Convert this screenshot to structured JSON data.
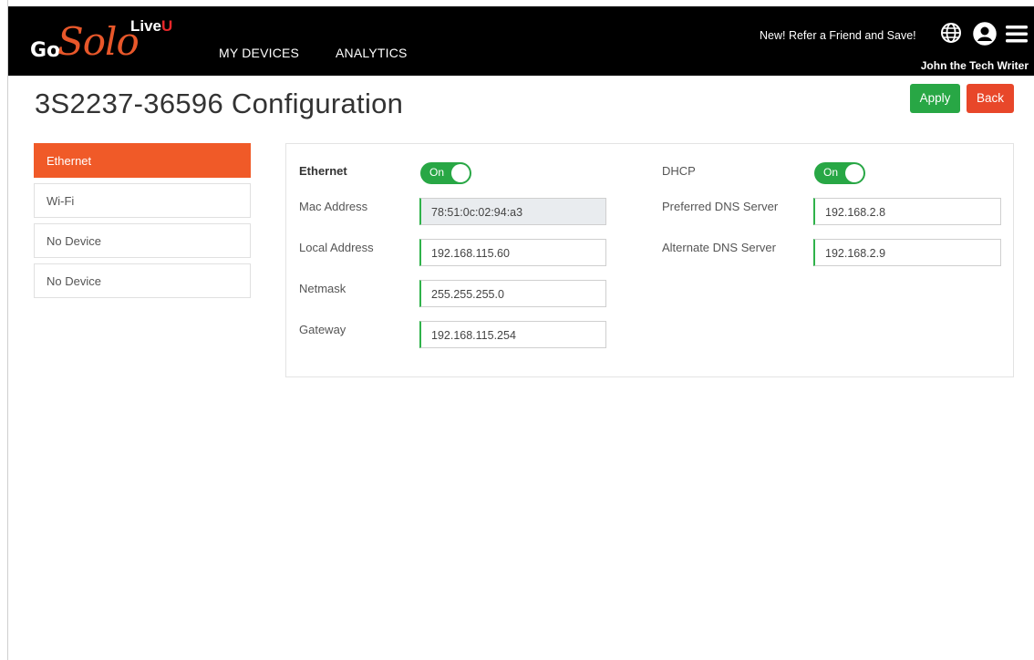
{
  "brand": {
    "go": "Go",
    "solo": "Solo",
    "live": "Live",
    "u": "U"
  },
  "nav": {
    "items": [
      {
        "label": "MY DEVICES"
      },
      {
        "label": "ANALYTICS"
      }
    ]
  },
  "header": {
    "promo": "New! Refer a Friend and Save!",
    "user": "John the Tech Writer"
  },
  "page": {
    "title": "3S2237-36596 Configuration"
  },
  "actions": {
    "apply": "Apply",
    "back": "Back"
  },
  "sidebar": {
    "items": [
      {
        "label": "Ethernet"
      },
      {
        "label": "Wi-Fi"
      },
      {
        "label": "No Device"
      },
      {
        "label": "No Device"
      }
    ]
  },
  "ethernet": {
    "toggle_label": "Ethernet",
    "toggle_state": "On",
    "mac_label": "Mac Address",
    "mac": "78:51:0c:02:94:a3",
    "local_label": "Local Address",
    "local": "192.168.115.60",
    "netmask_label": "Netmask",
    "netmask": "255.255.255.0",
    "gateway_label": "Gateway",
    "gateway": "192.168.115.254"
  },
  "dhcp": {
    "label": "DHCP",
    "state": "On",
    "dns1_label": "Preferred DNS Server",
    "dns1": "192.168.2.8",
    "dns2_label": "Alternate DNS Server",
    "dns2": "192.168.2.9"
  },
  "colors": {
    "accent": "#f05a28",
    "apply": "#28a745",
    "back": "#e8472a",
    "toggle": "#28a745"
  }
}
